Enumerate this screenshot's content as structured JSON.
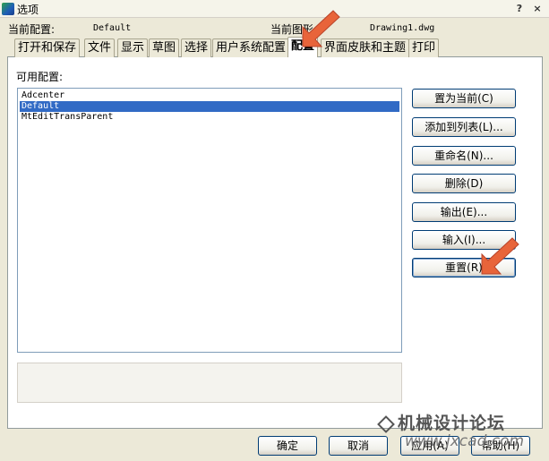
{
  "window": {
    "title": "选项",
    "help_glyph": "?",
    "close_glyph": "×"
  },
  "info": {
    "profile_label": "当前配置:",
    "profile_value": "Default",
    "drawing_label": "当前图形:",
    "drawing_value": "Drawing1.dwg"
  },
  "tabs": [
    {
      "label": "打开和保存"
    },
    {
      "label": "文件"
    },
    {
      "label": "显示"
    },
    {
      "label": "草图"
    },
    {
      "label": "选择"
    },
    {
      "label": "用户系统配置"
    },
    {
      "label": "配置",
      "active": true
    },
    {
      "label": "界面皮肤和主题"
    },
    {
      "label": "打印"
    }
  ],
  "profiles": {
    "label": "可用配置:",
    "items": [
      {
        "name": "Adcenter"
      },
      {
        "name": "Default",
        "selected": true
      },
      {
        "name": "MtEditTransParent"
      }
    ]
  },
  "actions": {
    "set_current": "置为当前(C)",
    "add_to_list": "添加到列表(L)...",
    "rename": "重命名(N)...",
    "delete": "删除(D)",
    "export": "输出(E)...",
    "import": "输入(I)...",
    "reset": "重置(R)"
  },
  "footer": {
    "ok": "确定",
    "cancel": "取消",
    "apply": "应用(A)",
    "help": "帮助(H)"
  },
  "colors": {
    "selection": "#316AC5",
    "annotation_arrow": "#E8643A"
  },
  "watermark": {
    "site_name": "机械设计论坛",
    "url": "www.jxcad.com"
  }
}
